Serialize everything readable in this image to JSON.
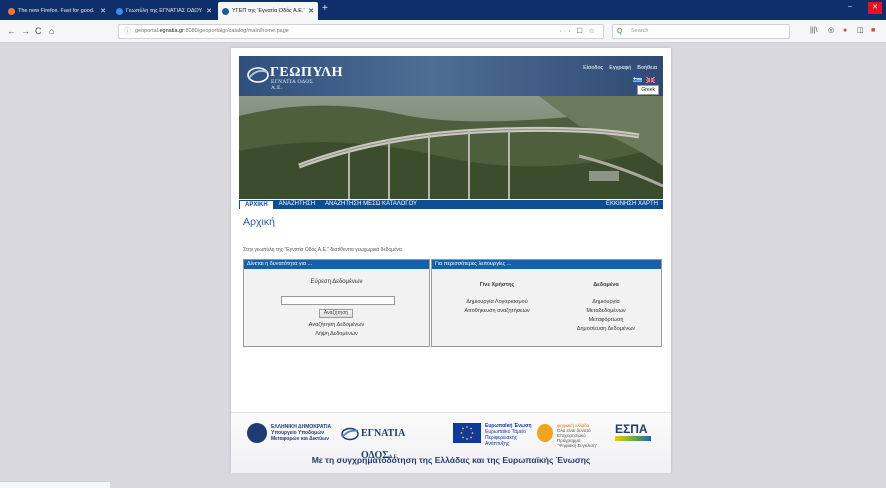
{
  "browser": {
    "tabs": [
      {
        "label": "The new Firefox. Fast for good.",
        "color": "#ff7139"
      },
      {
        "label": "Γεωπύλη της ΕΓΝΑΤΙΑΣ ΟΔΟΥ",
        "color": "#3d8be8"
      },
      {
        "label": "ΥΓΕΠ της 'Εγνατία Οδός Α.Ε.'",
        "color": "#1a5d9e"
      }
    ],
    "new_tab": "+",
    "url_prefix": "geoportal.",
    "url_domain": "egnatia.gr",
    "url_rest": ":8080/geoportalgr/catalog/main/home.page",
    "page_actions": "··· ☐ ☆",
    "search_placeholder": "Search",
    "nav": {
      "back": "←",
      "forward": "→",
      "reload": "C",
      "home": "⌂"
    }
  },
  "site": {
    "logo_text": "ΓΕΩΠΥΛΗ",
    "logo_sub": "ΕΓΝΑΤΙΑ ΟΔΟΣ Α.Ε.",
    "top_links": [
      "Είσοδος",
      "Εγγραφή",
      "Βοήθεια"
    ],
    "tooltip": "Greek",
    "menu": [
      "ΑΡΧΙΚΗ",
      "ΑΝΑΖΗΤΗΣΗ",
      "ΑΝΑΖΗΤΗΣΗ ΜΕΣΩ ΚΑΤΑΛΟΓΟΥ"
    ],
    "menu_right": "ΕΚΚΙΝΗΣΗ ΧΑΡΤΗ",
    "page_title": "Αρχική",
    "intro": "Στην γεωπύλη της \"Εγνατία Οδός Α.Ε.\" διατίθενται γεωχωρικά δεδομένα."
  },
  "panel_left": {
    "heading": "Δίνεται η δυνατότητα για ...",
    "title": "Εύρεση Δεδομένων",
    "search_value": "",
    "button": "Αναζήτηση",
    "links": [
      "Αναζήτηση Δεδομένων",
      "Λήψη Δεδομένων"
    ]
  },
  "panel_right": {
    "heading": "Για περισσότερες λειτουργίες ...",
    "col1_title": "Γίνε Χρήστης",
    "col1_items": [
      "Δημιουργία Λογαριασμού",
      "Αποθήκευση αναζητήσεων"
    ],
    "col2_title": "Δεδομένα",
    "col2_items": [
      "Δημιουργία",
      "Μεταδεδομένων",
      "Μεταφόρτωση",
      "Δημοσίευση Δεδομένων"
    ]
  },
  "footer": {
    "ministry": [
      "ΕΛΛΗΝΙΚΗ ΔΗΜΟΚΡΑΤΙΑ",
      "Υπουργείο Υποδομών",
      "Μεταφορών και Δικτύων"
    ],
    "egnatia": "ΕΓΝΑΤΙΑ ΟΔΟΣ",
    "egnatia_suffix": "Α.Ε.",
    "eu": [
      "Ευρωπαϊκή Ένωση",
      "Ευρωπαϊκό Ταμείο",
      "Περιφερειακής",
      "Ανάπτυξης"
    ],
    "digital": [
      "ψηφιακή ελλάδα",
      "Όλα είναι δυνατά",
      "Επιχειρησιακό Πρόγραμμα",
      "\"Ψηφιακή Σύγκλιση\""
    ],
    "espa": "ΕΣΠΑ",
    "slogan": "Με τη συγχρηματοδότηση της Ελλάδας και της Ευρωπαϊκής Ένωσης"
  }
}
